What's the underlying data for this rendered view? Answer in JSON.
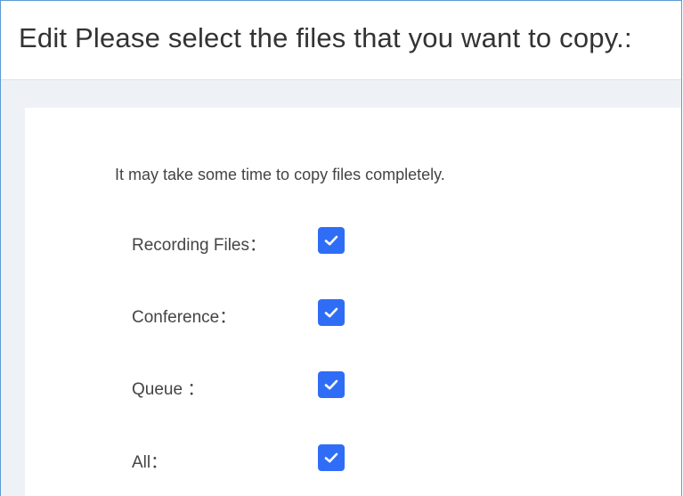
{
  "dialog": {
    "title": "Edit Please select the files that you want to copy.:"
  },
  "panel": {
    "notice": "It may take some time to copy files completely.",
    "options": [
      {
        "label": "Recording Files：",
        "checked": true,
        "icon": "checkmark-icon"
      },
      {
        "label": "Conference：",
        "checked": true,
        "icon": "checkmark-icon"
      },
      {
        "label": "Queue ：",
        "checked": true,
        "icon": "checkmark-icon"
      },
      {
        "label": "All：",
        "checked": true,
        "icon": "checkmark-icon"
      }
    ]
  },
  "colors": {
    "accent": "#2f6df6",
    "border": "#5b9bd5",
    "background": "#eef2f6"
  }
}
